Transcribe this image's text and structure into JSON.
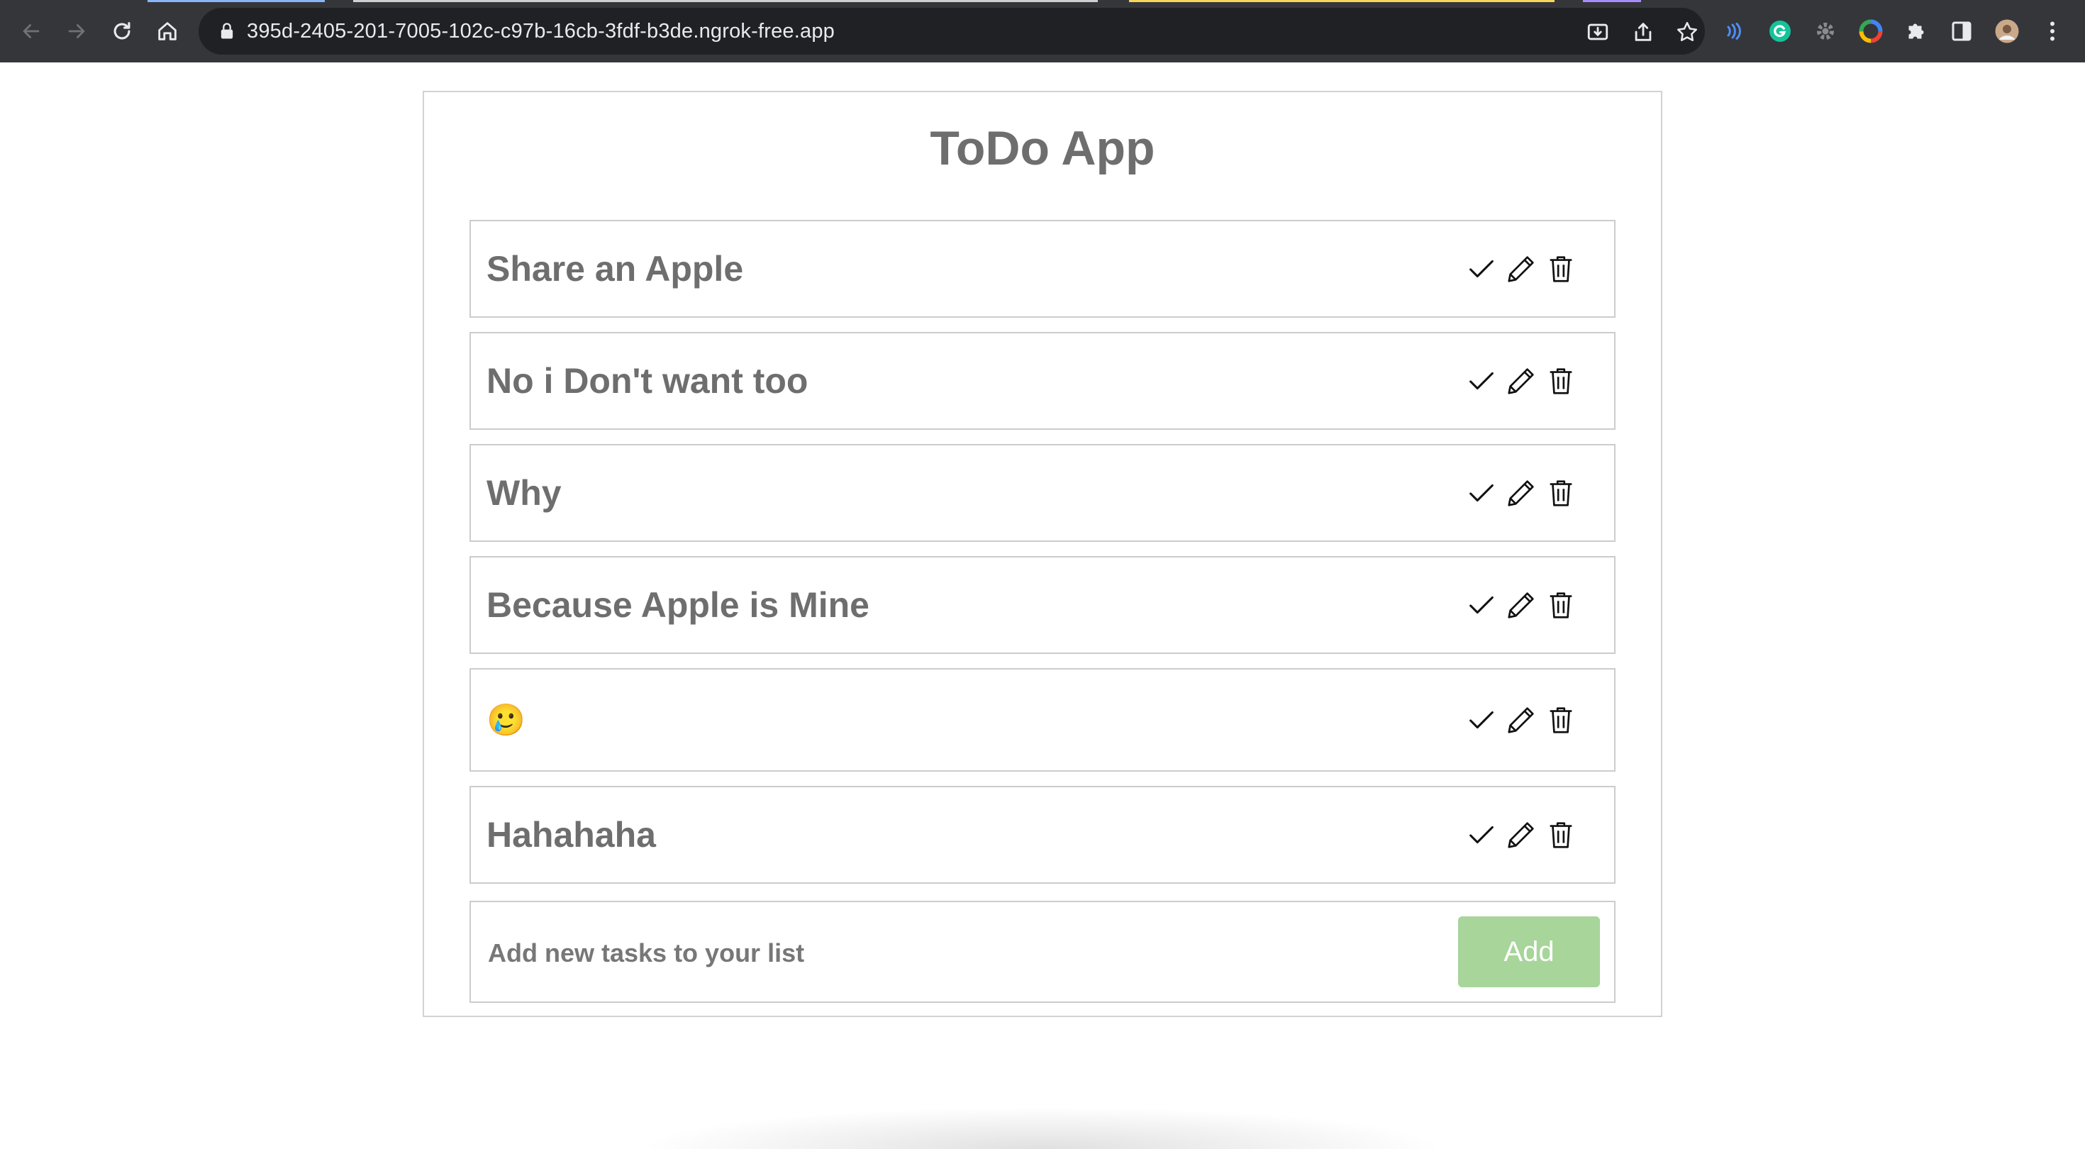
{
  "browser": {
    "url": "395d-2405-201-7005-102c-c97b-16cb-3fdf-b3de.ngrok-free.app",
    "icons": {
      "back": "arrow-left-icon",
      "forward": "arrow-right-icon",
      "reload": "reload-icon",
      "home": "home-icon",
      "lock": "lock-icon",
      "install": "install-icon",
      "share": "share-icon",
      "bookmark": "star-icon"
    },
    "extensions": [
      "wave-extension-icon",
      "grammarly-icon",
      "gear-extension-icon",
      "color-wheel-icon",
      "puzzle-icon",
      "side-panel-icon",
      "profile-avatar",
      "kebab-menu-icon"
    ]
  },
  "app": {
    "title": "ToDo App",
    "tasks": [
      {
        "text": "Share an Apple"
      },
      {
        "text": "No i Don't want too"
      },
      {
        "text": "Why"
      },
      {
        "text": "Because Apple is Mine"
      },
      {
        "text": "🥲"
      },
      {
        "text": "Hahahaha"
      }
    ],
    "task_action_icons": [
      "check-icon",
      "pencil-icon",
      "trash-icon"
    ],
    "add": {
      "placeholder": "Add new tasks to your list",
      "button_label": "Add"
    }
  },
  "colors": {
    "chrome_bg": "#35363a",
    "omnibox_bg": "#202124",
    "title_text": "#6e6e6e",
    "border": "#cccccc",
    "add_button": "#a7d59a"
  }
}
